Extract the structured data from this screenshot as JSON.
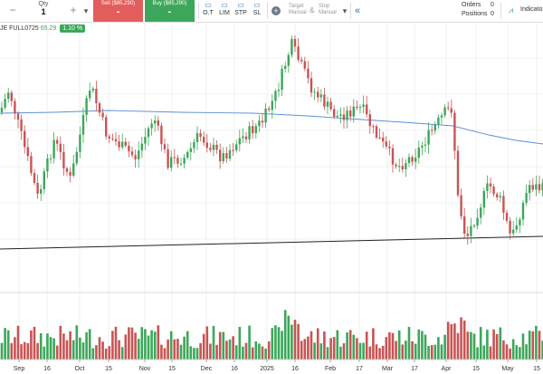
{
  "toolbar": {
    "minus": "−",
    "qty_label": "Qty",
    "qty_value": "1",
    "plus": "+",
    "sell_label": "Sell ($85,290)",
    "sell_value": "-",
    "buy_label": "Buy ($85,290)",
    "buy_value": "-",
    "order_types": [
      "O.T",
      "LIM",
      "STP",
      "SL"
    ],
    "target_text": "Target",
    "target_sub": "Manual",
    "amp": "&",
    "stop_text": "Stop",
    "stop_sub": "Manual",
    "orders_label": "Orders",
    "orders_value": "0",
    "positions_label": "Positions",
    "positions_value": "0",
    "indicators_label": "Indicato"
  },
  "legend": {
    "symbol": "JE FULL0725",
    "price": "65.29",
    "change": "1.10 %"
  },
  "chart_data": {
    "type": "candlestick",
    "x_tick_labels": [
      "Sep",
      "16",
      "Oct",
      "15",
      "Nov",
      "15",
      "Dec",
      "16",
      "2025",
      "16",
      "Feb",
      "17",
      "Mar",
      "17",
      "Apr",
      "15",
      "May",
      "15"
    ],
    "colors": {
      "up": "#3ca75a",
      "down": "#c85454",
      "ma": "#5b8fd6",
      "trend": "#222222"
    }
  }
}
